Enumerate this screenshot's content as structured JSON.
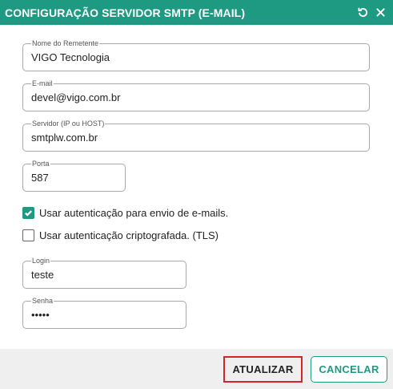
{
  "dialog": {
    "title": "CONFIGURAÇÃO SERVIDOR SMTP (E-MAIL)",
    "icons": [
      "refresh-icon",
      "close-icon"
    ]
  },
  "fields": {
    "sender_name": {
      "label": "Nome do Remetente",
      "value": "VIGO Tecnologia"
    },
    "email": {
      "label": "E-mail",
      "value": "devel@vigo.com.br"
    },
    "server": {
      "label": "Servidor (IP ou HOST)",
      "value": "smtplw.com.br"
    },
    "port": {
      "label": "Porta",
      "value": "587"
    },
    "login": {
      "label": "Login",
      "value": "teste"
    },
    "password": {
      "label": "Senha",
      "value": "•••••"
    }
  },
  "options": {
    "use_auth": {
      "label": "Usar autenticação para envio de e-mails.",
      "checked": true
    },
    "use_tls": {
      "label": "Usar autenticação criptografada. (TLS)",
      "checked": false
    }
  },
  "buttons": {
    "update_label": "ATUALIZAR",
    "cancel_label": "CANCELAR"
  },
  "colors": {
    "accent": "#1f9a82",
    "highlight_border": "#d9232a"
  }
}
